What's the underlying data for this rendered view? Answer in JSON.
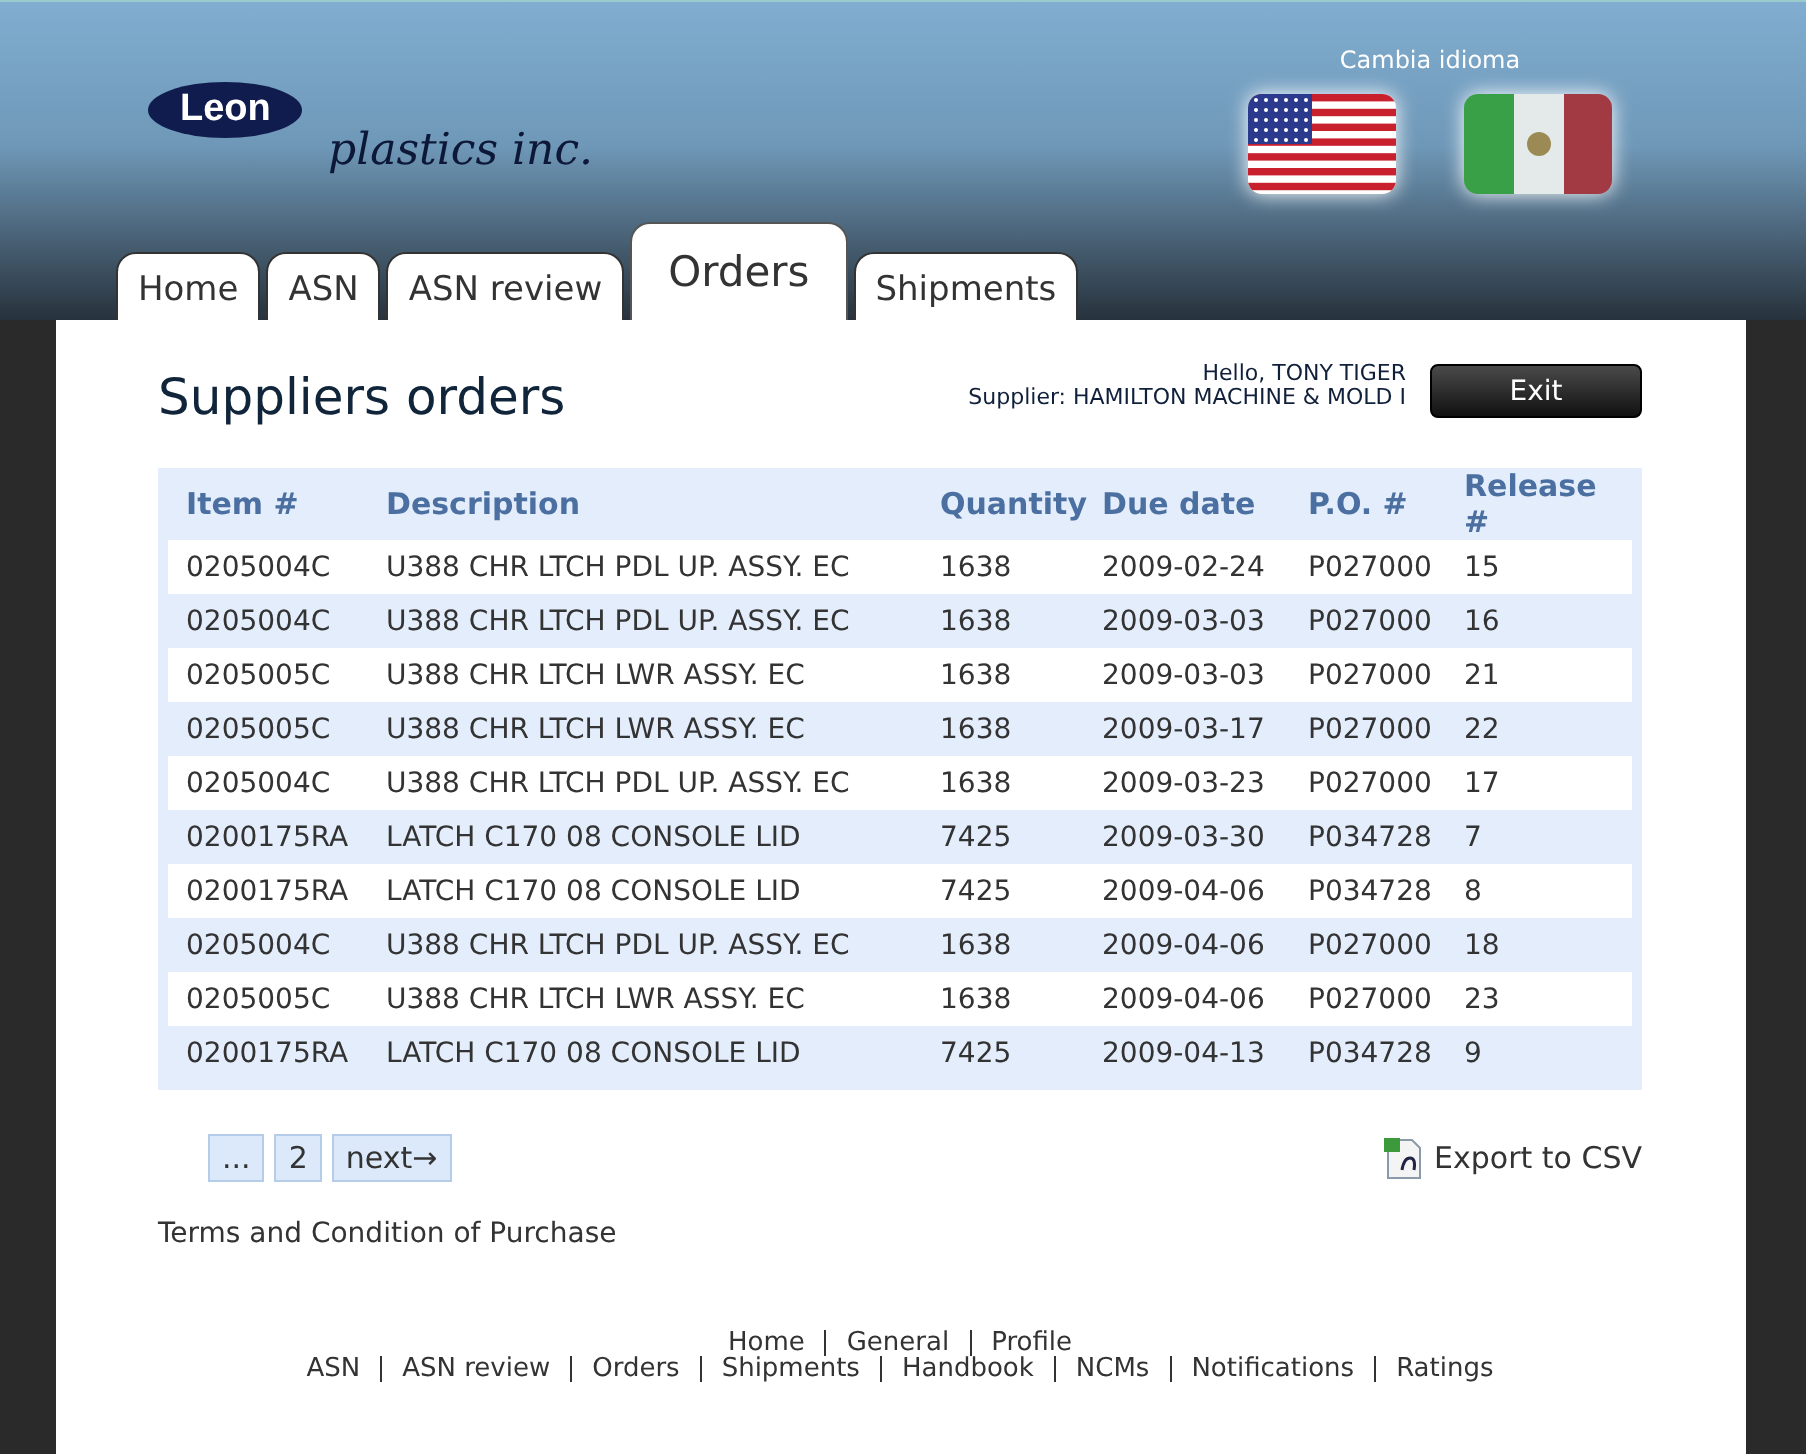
{
  "header": {
    "logo": {
      "badge": "Leon",
      "script": "plastics inc."
    },
    "language_label": "Cambia idioma",
    "languages": [
      {
        "kind": "us"
      },
      {
        "kind": "mx"
      }
    ]
  },
  "tabs": [
    {
      "label": "Home",
      "selected": false
    },
    {
      "label": "ASN",
      "selected": false
    },
    {
      "label": "ASN review",
      "selected": false
    },
    {
      "label": "Orders",
      "selected": true
    },
    {
      "label": "Shipments",
      "selected": false
    }
  ],
  "page_title": "Suppliers orders",
  "user": {
    "greeting": "Hello, TONY TIGER",
    "supplier": "Supplier: HAMILTON MACHINE & MOLD I",
    "exit_button": "Exit"
  },
  "table": {
    "columns": [
      "Item #",
      "Description",
      "Quantity",
      "Due date",
      "P.O. #",
      "Release #"
    ],
    "rows": [
      [
        "0205004C",
        "U388 CHR LTCH PDL UP. ASSY. EC",
        "1638",
        "2009-02-24",
        "P027000",
        "15"
      ],
      [
        "0205004C",
        "U388 CHR LTCH PDL UP. ASSY. EC",
        "1638",
        "2009-03-03",
        "P027000",
        "16"
      ],
      [
        "0205005C",
        "U388 CHR LTCH LWR ASSY. EC",
        "1638",
        "2009-03-03",
        "P027000",
        "21"
      ],
      [
        "0205005C",
        "U388 CHR LTCH LWR ASSY. EC",
        "1638",
        "2009-03-17",
        "P027000",
        "22"
      ],
      [
        "0205004C",
        "U388 CHR LTCH PDL UP. ASSY. EC",
        "1638",
        "2009-03-23",
        "P027000",
        "17"
      ],
      [
        "0200175RA",
        "LATCH C170 08 CONSOLE LID",
        "7425",
        "2009-03-30",
        "P034728",
        "7"
      ],
      [
        "0200175RA",
        "LATCH C170 08 CONSOLE LID",
        "7425",
        "2009-04-06",
        "P034728",
        "8"
      ],
      [
        "0205004C",
        "U388 CHR LTCH PDL UP. ASSY. EC",
        "1638",
        "2009-04-06",
        "P027000",
        "18"
      ],
      [
        "0205005C",
        "U388 CHR LTCH LWR ASSY. EC",
        "1638",
        "2009-04-06",
        "P027000",
        "23"
      ],
      [
        "0200175RA",
        "LATCH C170 08 CONSOLE LID",
        "7425",
        "2009-04-13",
        "P034728",
        "9"
      ]
    ]
  },
  "pagination": [
    "...",
    "2",
    "next→"
  ],
  "export_link": "Export to CSV",
  "terms_link": "Terms and Condition of Purchase",
  "footer": {
    "row_1": [
      "Home",
      "General",
      "Profile"
    ],
    "row_2": [
      "ASN",
      "ASN review",
      "Orders",
      "Shipments",
      "Handbook",
      "NCMs",
      "Notifications",
      "Ratings"
    ]
  }
}
